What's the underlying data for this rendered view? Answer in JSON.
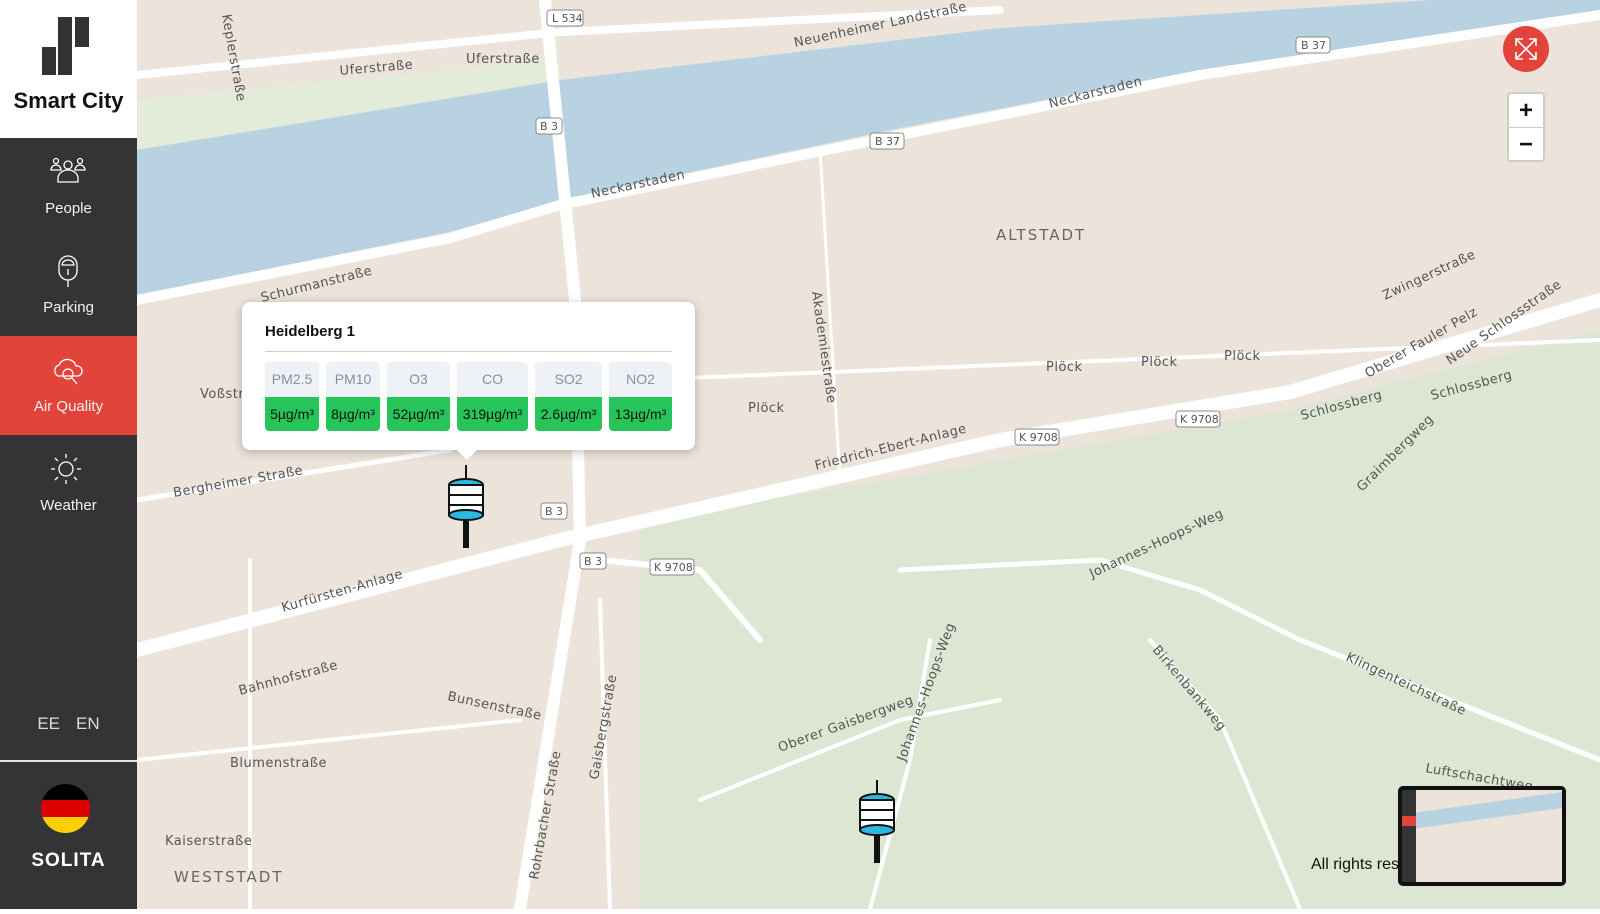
{
  "app": {
    "title": "Smart City",
    "brand": "SOLITA",
    "accent": "#e2433b"
  },
  "sidebar": {
    "items": [
      {
        "label": "People",
        "icon": "people-icon",
        "active": false
      },
      {
        "label": "Parking",
        "icon": "parking-meter-icon",
        "active": false
      },
      {
        "label": "Air Quality",
        "icon": "cloud-search-icon",
        "active": true
      },
      {
        "label": "Weather",
        "icon": "sun-icon",
        "active": false
      }
    ],
    "languages": [
      "EE",
      "EN"
    ]
  },
  "popup": {
    "title": "Heidelberg 1",
    "measurements": [
      {
        "key": "PM2.5",
        "value": "5µg/m³"
      },
      {
        "key": "PM10",
        "value": "8µg/m³"
      },
      {
        "key": "O3",
        "value": "52µg/m³"
      },
      {
        "key": "CO",
        "value": "319µg/m³"
      },
      {
        "key": "SO2",
        "value": "2.6µg/m³"
      },
      {
        "key": "NO2",
        "value": "13µg/m³"
      }
    ],
    "status_color": "#27c45a"
  },
  "map": {
    "controls": {
      "zoom_in": "+",
      "zoom_out": "−",
      "fullscreen_icon": "expand-icon"
    },
    "attribution": "All rights res",
    "labels": {
      "neuenheimer": "Neuenheimer Landstraße",
      "uferstrasse1": "Uferstraße",
      "uferstrasse2": "Uferstraße",
      "neckarstaden1": "Neckarstaden",
      "neckarstaden2": "Neckarstaden",
      "schurman": "Schurmanstraße",
      "altstadt": "ALTSTADT",
      "plock1": "Plöck",
      "plock2": "Plöck",
      "plock3": "Plöck",
      "plock4": "Plöck",
      "friedrich": "Friedrich-Ebert-Anlage",
      "kurfursten": "Kurfürsten-Anlage",
      "bergheimer": "Bergheimer Straße",
      "bahnhof": "Bahnhofstraße",
      "bunsen": "Bunsenstraße",
      "blumen": "Blumenstraße",
      "kaiser": "Kaiserstraße",
      "weststadt": "WESTSTADT",
      "rohrbacher": "Rohrbacher Straße",
      "gaisberg": "Gaisbergstraße",
      "akademie": "Akademiestraße",
      "johannes1": "Johannes-Hoops-Weg",
      "johannes2": "Johannes-Hoops-Weg",
      "oberer": "Oberer Gaisbergweg",
      "birkenbank": "Birkenbankweg",
      "klingen": "Klingenteichstraße",
      "luft": "Luftschachtweg",
      "schlossberg1": "Schlossberg",
      "schlossberg2": "Schlossberg",
      "zwinger": "Zwingerstraße",
      "faulerpelz": "Oberer Fauler Pelz",
      "neueschloss": "Neue Schlossstraße",
      "graim": "Graimbergweg",
      "kepler": "Keplerstraße",
      "voss": "Voßstra"
    },
    "shields": {
      "l534": "L 534",
      "b37a": "B 37",
      "b37b": "B 37",
      "b3a": "B 3",
      "b3b": "B 3",
      "b3c": "B 3",
      "k9708a": "K 9708",
      "k9708b": "K 9708",
      "k9708c": "K 9708"
    }
  }
}
